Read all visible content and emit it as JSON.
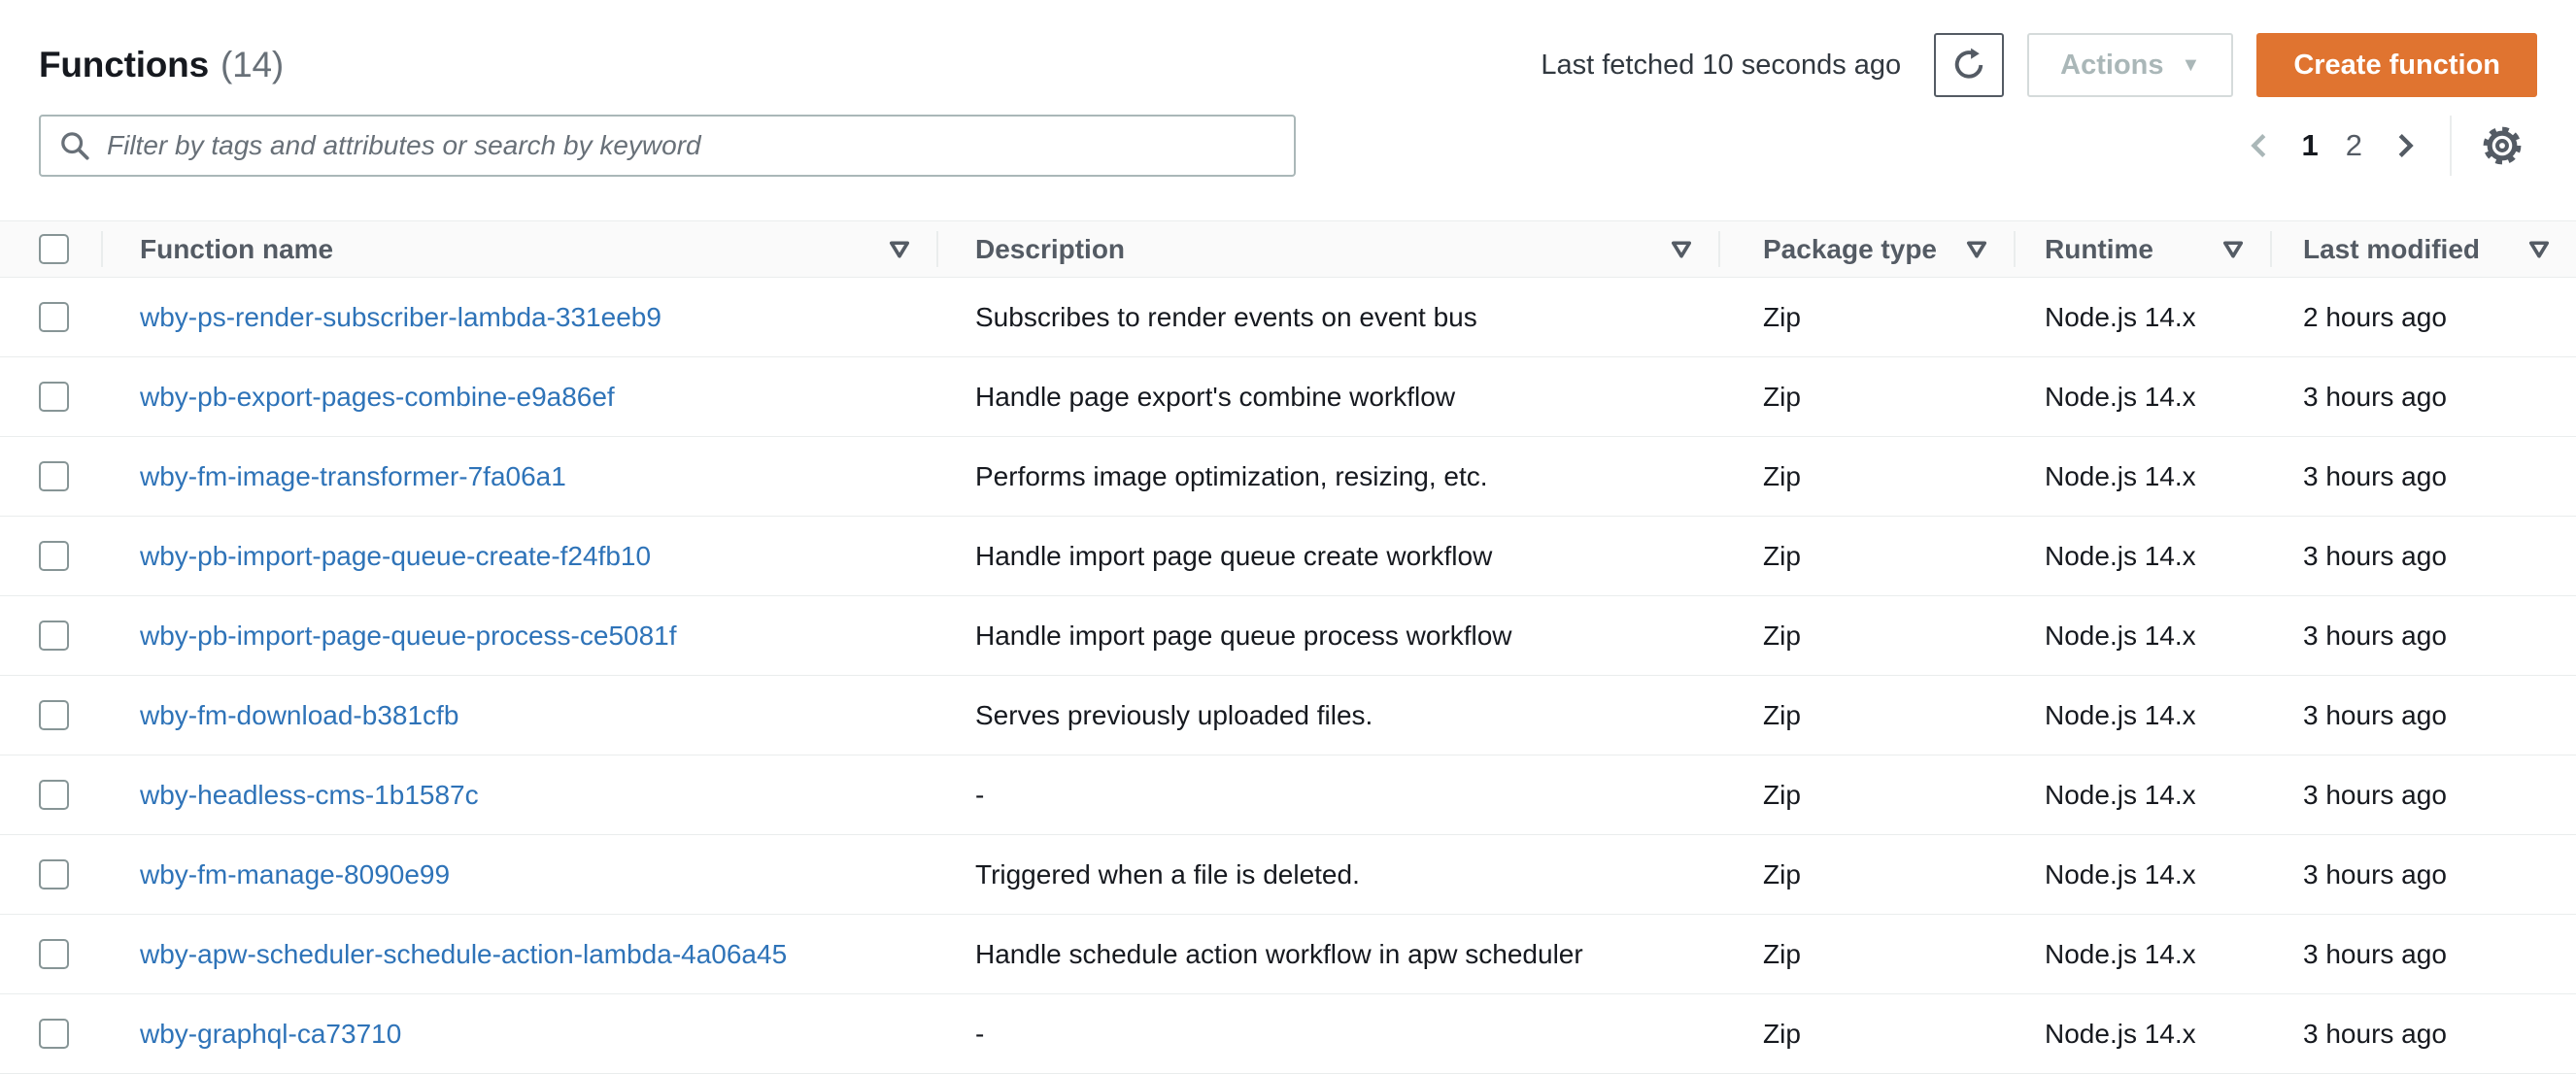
{
  "header": {
    "title": "Functions",
    "count": "(14)",
    "last_fetched": "Last fetched 10 seconds ago",
    "actions_label": "Actions",
    "actions_caret": "▼",
    "create_label": "Create function"
  },
  "search": {
    "placeholder": "Filter by tags and attributes or search by keyword",
    "value": ""
  },
  "pagination": {
    "current_page": "1",
    "next_page": "2"
  },
  "icons": {
    "search": "search-icon",
    "refresh": "refresh-icon",
    "gear": "gear-icon",
    "chevron_left": "chevron-left-icon",
    "chevron_right": "chevron-right-icon",
    "sort": "sort-arrow-icon"
  },
  "colors": {
    "accent_orange": "#e07430",
    "link_blue": "#2e73b8",
    "header_text": "#545b64",
    "body_text": "#16191f",
    "muted_text": "#687078",
    "disabled_text": "#aab7b8",
    "border_light": "#eaeded",
    "border_input": "#aab7b8",
    "header_bg": "#fafafa"
  },
  "table": {
    "columns": [
      "Function name",
      "Description",
      "Package type",
      "Runtime",
      "Last modified"
    ],
    "rows": [
      {
        "name": "wby-ps-render-subscriber-lambda-331eeb9",
        "description": "Subscribes to render events on event bus",
        "package_type": "Zip",
        "runtime": "Node.js 14.x",
        "last_modified": "2 hours ago"
      },
      {
        "name": "wby-pb-export-pages-combine-e9a86ef",
        "description": "Handle page export's combine workflow",
        "package_type": "Zip",
        "runtime": "Node.js 14.x",
        "last_modified": "3 hours ago"
      },
      {
        "name": "wby-fm-image-transformer-7fa06a1",
        "description": "Performs image optimization, resizing, etc.",
        "package_type": "Zip",
        "runtime": "Node.js 14.x",
        "last_modified": "3 hours ago"
      },
      {
        "name": "wby-pb-import-page-queue-create-f24fb10",
        "description": "Handle import page queue create workflow",
        "package_type": "Zip",
        "runtime": "Node.js 14.x",
        "last_modified": "3 hours ago"
      },
      {
        "name": "wby-pb-import-page-queue-process-ce5081f",
        "description": "Handle import page queue process workflow",
        "package_type": "Zip",
        "runtime": "Node.js 14.x",
        "last_modified": "3 hours ago"
      },
      {
        "name": "wby-fm-download-b381cfb",
        "description": "Serves previously uploaded files.",
        "package_type": "Zip",
        "runtime": "Node.js 14.x",
        "last_modified": "3 hours ago"
      },
      {
        "name": "wby-headless-cms-1b1587c",
        "description": "-",
        "package_type": "Zip",
        "runtime": "Node.js 14.x",
        "last_modified": "3 hours ago"
      },
      {
        "name": "wby-fm-manage-8090e99",
        "description": "Triggered when a file is deleted.",
        "package_type": "Zip",
        "runtime": "Node.js 14.x",
        "last_modified": "3 hours ago"
      },
      {
        "name": "wby-apw-scheduler-schedule-action-lambda-4a06a45",
        "description": "Handle schedule action workflow in apw scheduler",
        "package_type": "Zip",
        "runtime": "Node.js 14.x",
        "last_modified": "3 hours ago"
      },
      {
        "name": "wby-graphql-ca73710",
        "description": "-",
        "package_type": "Zip",
        "runtime": "Node.js 14.x",
        "last_modified": "3 hours ago"
      }
    ]
  }
}
